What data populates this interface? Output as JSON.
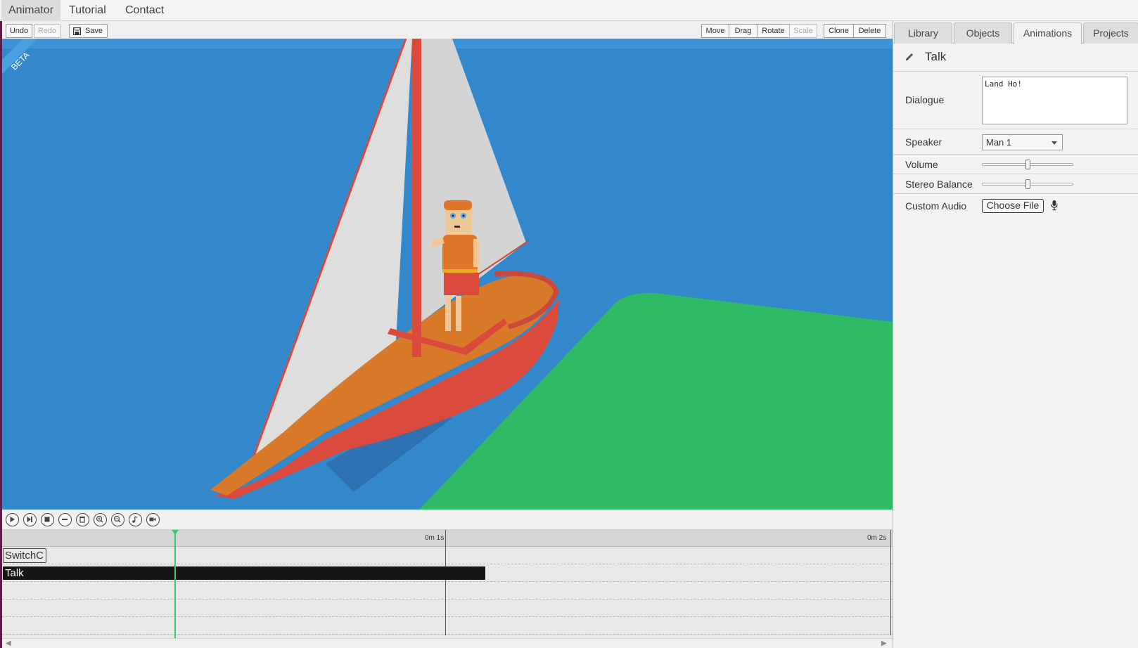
{
  "menu": {
    "animator": "Animator",
    "tutorial": "Tutorial",
    "contact": "Contact"
  },
  "toolbar": {
    "undo": "Undo",
    "redo": "Redo",
    "save": "Save",
    "move": "Move",
    "drag": "Drag",
    "rotate": "Rotate",
    "scale": "Scale",
    "clone": "Clone",
    "delete": "Delete"
  },
  "viewport": {
    "badge": "BETA"
  },
  "timeline": {
    "ticks": [
      "0m 1s",
      "0m 2s"
    ],
    "clips": {
      "switch": "SwitchC",
      "talk": "Talk"
    }
  },
  "panel": {
    "tabs": [
      "Library",
      "Objects",
      "Animations",
      "Projects"
    ],
    "active_tab": "Animations",
    "title": "Talk",
    "dialogue_label": "Dialogue",
    "dialogue_value": "Land Ho!",
    "speaker_label": "Speaker",
    "speaker_value": "Man 1",
    "volume_label": "Volume",
    "volume_value": 0.5,
    "stereo_label": "Stereo Balance",
    "stereo_value": 0.5,
    "audio_label": "Custom Audio",
    "choose_file": "Choose File"
  },
  "colors": {
    "water": "#3388cc",
    "grass": "#2fbb66",
    "boat": "#d97a2a",
    "mast": "#d94a3c",
    "sail": "#dcdcdc",
    "playhead": "#33cc66"
  }
}
